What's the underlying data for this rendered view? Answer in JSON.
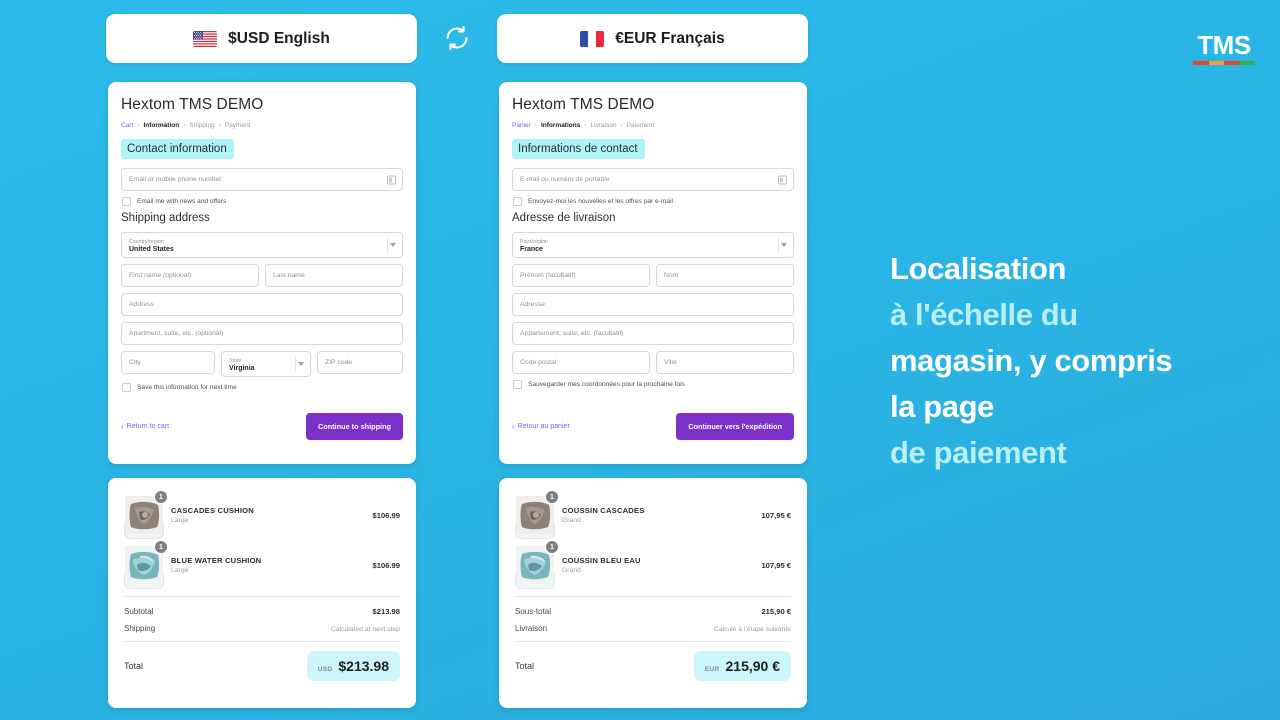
{
  "logo": {
    "wordmark": "TMS",
    "bar_colors": [
      "#e8442b",
      "#f0a32a",
      "#e8442b",
      "#3faa4a"
    ]
  },
  "header": {
    "left_pill": {
      "label": "$USD English",
      "flag": "us-flag-icon"
    },
    "right_pill": {
      "label": "€EUR Français",
      "flag": "fr-flag-icon"
    },
    "swap_icon": "refresh-swap-icon"
  },
  "headline": {
    "lines": [
      {
        "text": "Localisation",
        "accent": false
      },
      {
        "text": "à l'échelle du",
        "accent": true
      },
      {
        "text": "magasin, y compris",
        "accent": false
      },
      {
        "text": "la page",
        "accent": false
      },
      {
        "text": "de paiement",
        "accent": true
      }
    ]
  },
  "checkout_en": {
    "store_title": "Hextom TMS DEMO",
    "breadcrumbs": [
      {
        "label": "Cart",
        "state": "link"
      },
      {
        "label": "Information",
        "state": "active"
      },
      {
        "label": "Shipping",
        "state": "muted"
      },
      {
        "label": "Payment",
        "state": "muted"
      }
    ],
    "contact_heading": "Contact information",
    "email_placeholder": "Email or mobile phone number",
    "newsletter_label": "Email me with news and offers",
    "shipping_heading": "Shipping address",
    "country_label": "Country/region",
    "country_value": "United States",
    "first_name_placeholder": "First name (optional)",
    "last_name_placeholder": "Last name",
    "address_placeholder": "Address",
    "apartment_placeholder": "Apartment, suite, etc. (optional)",
    "city_placeholder": "City",
    "state_label": "State",
    "state_value": "Virginia",
    "zip_placeholder": "ZIP code",
    "save_info_label": "Save this information for next time",
    "back_label": "Return to cart",
    "cta_label": "Continue to shipping"
  },
  "checkout_fr": {
    "store_title": "Hextom TMS DEMO",
    "breadcrumbs": [
      {
        "label": "Panier",
        "state": "link"
      },
      {
        "label": "Informations",
        "state": "active"
      },
      {
        "label": "Livraison",
        "state": "muted"
      },
      {
        "label": "Paiement",
        "state": "muted"
      }
    ],
    "contact_heading": "Informations de contact",
    "email_placeholder": "E-mail ou numéro de portable",
    "newsletter_label": "Envoyez-moi les nouvelles et les offres par e-mail",
    "shipping_heading": "Adresse de livraison",
    "country_label": "Pays/région",
    "country_value": "France",
    "first_name_placeholder": "Prénom (facultatif)",
    "last_name_placeholder": "Nom",
    "address_placeholder": "Adresse",
    "apartment_placeholder": "Appartement, suite, etc. (facultatif)",
    "postal_placeholder": "Code postal",
    "city_placeholder": "Ville",
    "save_info_label": "Sauvegarder mes coordonnées pour la prochaine fois",
    "back_label": "Retour au panier",
    "cta_label": "Continuer vers l'expédition"
  },
  "summary_en": {
    "items": [
      {
        "name": "CASCADES CUSHION",
        "variant": "Large",
        "qty": "1",
        "price": "$106.99",
        "thumb": "cascades-cushion-thumbnail"
      },
      {
        "name": "BLUE WATER CUSHION",
        "variant": "Large",
        "qty": "1",
        "price": "$106.99",
        "thumb": "blue-water-cushion-thumbnail"
      }
    ],
    "subtotal_label": "Subtotal",
    "subtotal_value": "$213.98",
    "shipping_label": "Shipping",
    "shipping_value": "Calculated at next step",
    "total_label": "Total",
    "currency_code": "USD",
    "total_value": "$213.98"
  },
  "summary_fr": {
    "items": [
      {
        "name": "COUSSIN CASCADES",
        "variant": "Grand",
        "qty": "1",
        "price": "107,95 €",
        "thumb": "cascades-cushion-thumbnail"
      },
      {
        "name": "COUSSIN BLEU EAU",
        "variant": "Grand",
        "qty": "1",
        "price": "107,95 €",
        "thumb": "blue-water-cushion-thumbnail"
      }
    ],
    "subtotal_label": "Sous-total",
    "subtotal_value": "215,90 €",
    "shipping_label": "Livraison",
    "shipping_value": "Calculé à l'étape suivante",
    "total_label": "Total",
    "currency_code": "EUR",
    "total_value": "215,90 €"
  },
  "colors": {
    "background": "#2ab8e8",
    "accent_purple": "#7b31c9",
    "highlight_cyan": "#aef3f7",
    "badge_cyan": "#ccf6fb"
  }
}
